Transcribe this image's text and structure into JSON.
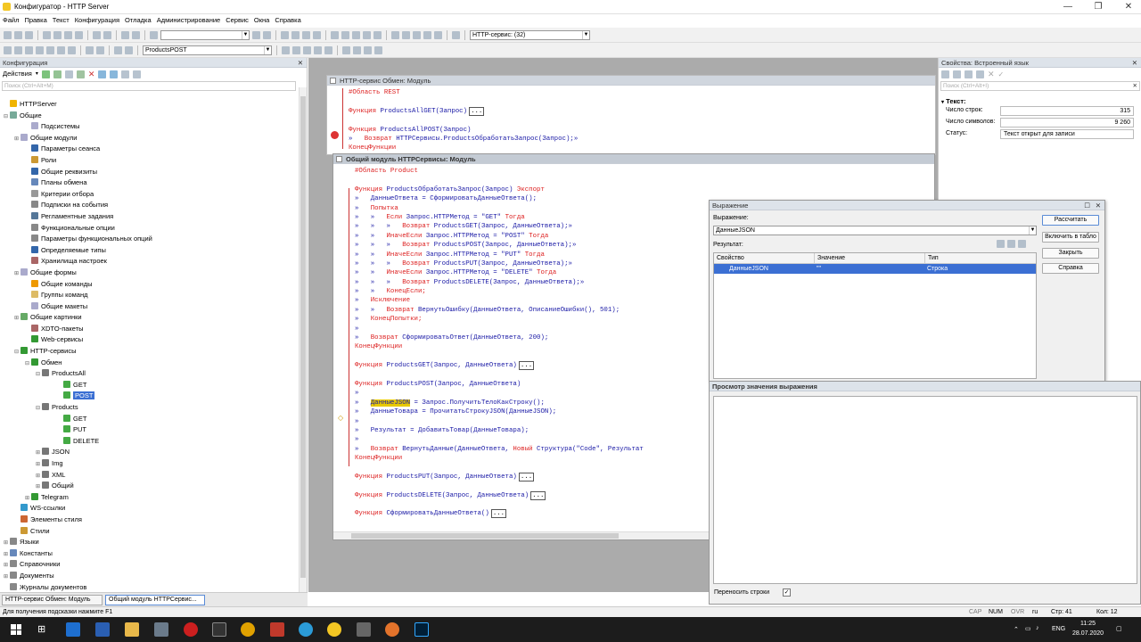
{
  "window": {
    "title": "Конфигуратор - HTTP Server"
  },
  "menu": [
    "Файл",
    "Правка",
    "Текст",
    "Конфигурация",
    "Отладка",
    "Администрирование",
    "Сервис",
    "Окна",
    "Справка"
  ],
  "toolbar": {
    "service_combo": "HTTP-сервис: (32)",
    "method_combo": "ProductsPOST"
  },
  "left": {
    "title": "Конфигурация",
    "actions": "Действия",
    "search_placeholder": "Поиск (Ctrl+Alt+M)",
    "tree": [
      {
        "t": "HTTPServer",
        "l": 0,
        "e": "",
        "c": "#f0b400"
      },
      {
        "t": "Общие",
        "l": 0,
        "e": "⊟",
        "c": "#7a9"
      },
      {
        "t": "Подсистемы",
        "l": 2,
        "e": "",
        "c": "#aac"
      },
      {
        "t": "Общие модули",
        "l": 1,
        "e": "⊞",
        "c": "#aac"
      },
      {
        "t": "Параметры сеанса",
        "l": 2,
        "e": "",
        "c": "#36a"
      },
      {
        "t": "Роли",
        "l": 2,
        "e": "",
        "c": "#c93"
      },
      {
        "t": "Общие реквизиты",
        "l": 2,
        "e": "",
        "c": "#36a"
      },
      {
        "t": "Планы обмена",
        "l": 2,
        "e": "",
        "c": "#68b"
      },
      {
        "t": "Критерии отбора",
        "l": 2,
        "e": "",
        "c": "#999"
      },
      {
        "t": "Подписки на события",
        "l": 2,
        "e": "",
        "c": "#888"
      },
      {
        "t": "Регламентные задания",
        "l": 2,
        "e": "",
        "c": "#579"
      },
      {
        "t": "Функциональные опции",
        "l": 2,
        "e": "",
        "c": "#888"
      },
      {
        "t": "Параметры функциональных опций",
        "l": 2,
        "e": "",
        "c": "#888"
      },
      {
        "t": "Определяемые типы",
        "l": 2,
        "e": "",
        "c": "#36a"
      },
      {
        "t": "Хранилища настроек",
        "l": 2,
        "e": "",
        "c": "#a66"
      },
      {
        "t": "Общие формы",
        "l": 1,
        "e": "⊞",
        "c": "#aac"
      },
      {
        "t": "Общие команды",
        "l": 2,
        "e": "",
        "c": "#e90"
      },
      {
        "t": "Группы команд",
        "l": 2,
        "e": "",
        "c": "#db6"
      },
      {
        "t": "Общие макеты",
        "l": 2,
        "e": "",
        "c": "#aac"
      },
      {
        "t": "Общие картинки",
        "l": 1,
        "e": "⊞",
        "c": "#6a6"
      },
      {
        "t": "XDTO-пакеты",
        "l": 2,
        "e": "",
        "c": "#a66"
      },
      {
        "t": "Web-сервисы",
        "l": 2,
        "e": "",
        "c": "#393"
      },
      {
        "t": "HTTP-сервисы",
        "l": 1,
        "e": "⊟",
        "c": "#393"
      },
      {
        "t": "Обмен",
        "l": 2,
        "e": "⊟",
        "c": "#393"
      },
      {
        "t": "ProductsAll",
        "l": 3,
        "e": "⊟",
        "c": "#777"
      },
      {
        "t": "GET",
        "l": 5,
        "e": "",
        "c": "#4a4"
      },
      {
        "t": "POST",
        "l": 5,
        "e": "",
        "c": "#4a4",
        "sel": true
      },
      {
        "t": "Products",
        "l": 3,
        "e": "⊟",
        "c": "#777"
      },
      {
        "t": "GET",
        "l": 5,
        "e": "",
        "c": "#4a4"
      },
      {
        "t": "PUT",
        "l": 5,
        "e": "",
        "c": "#4a4"
      },
      {
        "t": "DELETE",
        "l": 5,
        "e": "",
        "c": "#4a4"
      },
      {
        "t": "JSON",
        "l": 3,
        "e": "⊞",
        "c": "#777"
      },
      {
        "t": "Img",
        "l": 3,
        "e": "⊞",
        "c": "#777"
      },
      {
        "t": "XML",
        "l": 3,
        "e": "⊞",
        "c": "#777"
      },
      {
        "t": "Общий",
        "l": 3,
        "e": "⊞",
        "c": "#777"
      },
      {
        "t": "Telegram",
        "l": 2,
        "e": "⊞",
        "c": "#393"
      },
      {
        "t": "WS-ссылки",
        "l": 1,
        "e": "",
        "c": "#39c"
      },
      {
        "t": "Элементы стиля",
        "l": 1,
        "e": "",
        "c": "#c63"
      },
      {
        "t": "Стили",
        "l": 1,
        "e": "",
        "c": "#c93"
      },
      {
        "t": "Языки",
        "l": 0,
        "e": "⊞",
        "c": "#888"
      },
      {
        "t": "Константы",
        "l": 0,
        "e": "⊞",
        "c": "#68b"
      },
      {
        "t": "Справочники",
        "l": 0,
        "e": "⊞",
        "c": "#888"
      },
      {
        "t": "Документы",
        "l": 0,
        "e": "⊞",
        "c": "#888"
      },
      {
        "t": "Журналы документов",
        "l": 0,
        "e": "",
        "c": "#888"
      }
    ]
  },
  "editor1": {
    "title": "HTTP-сервис Обмен: Модуль",
    "lines": [
      [
        [
          "kw",
          "#Область REST"
        ]
      ],
      [],
      [
        [
          "kw",
          "Функция "
        ],
        [
          "fn",
          "ProductsAllGET(Запрос)"
        ],
        [
          "box",
          "..."
        ]
      ],
      [],
      [
        [
          "kw",
          "Функция "
        ],
        [
          "fn",
          "ProductsAllPOST(Запрос)"
        ]
      ],
      [
        [
          "p",
          "»   "
        ],
        [
          "kw",
          "Возврат "
        ],
        [
          "fn",
          "HTTPСервисы.ProductsОбработатьЗапрос(Запрос);"
        ],
        [
          "p",
          "»"
        ]
      ],
      [
        [
          "kw",
          "КонецФункции"
        ]
      ]
    ]
  },
  "editor2": {
    "title": "Общий модуль HTTPСервисы: Модуль",
    "lines": [
      [
        [
          "kw",
          "#Область Product"
        ]
      ],
      [],
      [
        [
          "kw",
          "Функция "
        ],
        [
          "fn",
          "ProductsОбработатьЗапрос(Запрос) "
        ],
        [
          "kw",
          "Экспорт"
        ]
      ],
      [
        [
          "p",
          "»   "
        ],
        [
          "fn",
          "ДанныеОтвета = СформироватьДанныеОтвета();"
        ]
      ],
      [
        [
          "p",
          "»   "
        ],
        [
          "kw",
          "Попытка"
        ]
      ],
      [
        [
          "p",
          "»   »   "
        ],
        [
          "kw",
          "Если "
        ],
        [
          "fn",
          "Запрос.HTTPМетод = \"GET\" "
        ],
        [
          "kw",
          "Тогда"
        ]
      ],
      [
        [
          "p",
          "»   »   »   "
        ],
        [
          "kw",
          "Возврат "
        ],
        [
          "fn",
          "ProductsGET(Запрос, ДанныеОтвета);"
        ],
        [
          "p",
          "»"
        ]
      ],
      [
        [
          "p",
          "»   »   "
        ],
        [
          "kw",
          "ИначеЕсли "
        ],
        [
          "fn",
          "Запрос.HTTPМетод = \"POST\" "
        ],
        [
          "kw",
          "Тогда"
        ]
      ],
      [
        [
          "p",
          "»   »   »   "
        ],
        [
          "kw",
          "Возврат "
        ],
        [
          "fn",
          "ProductsPOST(Запрос, ДанныеОтвета);"
        ],
        [
          "p",
          "»"
        ]
      ],
      [
        [
          "p",
          "»   »   "
        ],
        [
          "kw",
          "ИначеЕсли "
        ],
        [
          "fn",
          "Запрос.HTTPМетод = \"PUT\" "
        ],
        [
          "kw",
          "Тогда"
        ]
      ],
      [
        [
          "p",
          "»   »   »   "
        ],
        [
          "kw",
          "Возврат "
        ],
        [
          "fn",
          "ProductsPUT(Запрос, ДанныеОтвета);"
        ],
        [
          "p",
          "»"
        ]
      ],
      [
        [
          "p",
          "»   »   "
        ],
        [
          "kw",
          "ИначеЕсли "
        ],
        [
          "fn",
          "Запрос.HTTPМетод = \"DELETE\" "
        ],
        [
          "kw",
          "Тогда"
        ]
      ],
      [
        [
          "p",
          "»   »   »   "
        ],
        [
          "kw",
          "Возврат "
        ],
        [
          "fn",
          "ProductsDELETE(Запрос, ДанныеОтвета);"
        ],
        [
          "p",
          "»"
        ]
      ],
      [
        [
          "p",
          "»   »   "
        ],
        [
          "kw",
          "КонецЕсли;"
        ]
      ],
      [
        [
          "p",
          "»   "
        ],
        [
          "kw",
          "Исключение"
        ]
      ],
      [
        [
          "p",
          "»   »   "
        ],
        [
          "kw",
          "Возврат "
        ],
        [
          "fn",
          "ВернутьОшибку(ДанныеОтвета, ОписаниеОшибки(), 501);"
        ]
      ],
      [
        [
          "p",
          "»   "
        ],
        [
          "kw",
          "КонецПопытки;"
        ]
      ],
      [
        [
          "p",
          "»"
        ]
      ],
      [
        [
          "p",
          "»   "
        ],
        [
          "kw",
          "Возврат "
        ],
        [
          "fn",
          "СформироватьОтвет(ДанныеОтвета, 200);"
        ]
      ],
      [
        [
          "kw",
          "КонецФункции"
        ]
      ],
      [],
      [
        [
          "kw",
          "Функция "
        ],
        [
          "fn",
          "ProductsGET(Запрос, ДанныеОтвета)"
        ],
        [
          "box",
          "..."
        ]
      ],
      [],
      [
        [
          "kw",
          "Функция "
        ],
        [
          "fn",
          "ProductsPOST(Запрос, ДанныеОтвета)"
        ]
      ],
      [
        [
          "p",
          "»"
        ]
      ],
      [
        [
          "p",
          "»   "
        ],
        [
          "hl",
          "ДанныеJSON"
        ],
        [
          "fn",
          " = Запрос.ПолучитьТелоКакСтроку();"
        ]
      ],
      [
        [
          "p",
          "»   "
        ],
        [
          "fn",
          "ДанныеТовара = ПрочитатьСтрокуJSON(ДанныеJSON);"
        ]
      ],
      [
        [
          "p",
          "»"
        ]
      ],
      [
        [
          "p",
          "»   "
        ],
        [
          "fn",
          "Результат = ДобавитьТовар(ДанныеТовара);"
        ]
      ],
      [
        [
          "p",
          "»"
        ]
      ],
      [
        [
          "p",
          "»   "
        ],
        [
          "kw",
          "Возврат "
        ],
        [
          "fn",
          "ВернутьДанные(ДанныеОтвета, "
        ],
        [
          "kw",
          "Новый "
        ],
        [
          "fn",
          "Структура(\"Code\", Результат"
        ]
      ],
      [
        [
          "kw",
          "КонецФункции"
        ]
      ],
      [],
      [
        [
          "kw",
          "Функция "
        ],
        [
          "fn",
          "ProductsPUT(Запрос, ДанныеОтвета)"
        ],
        [
          "box",
          "..."
        ]
      ],
      [],
      [
        [
          "kw",
          "Функция "
        ],
        [
          "fn",
          "ProductsDELETE(Запрос, ДанныеОтвета)"
        ],
        [
          "box",
          "..."
        ]
      ],
      [],
      [
        [
          "kw",
          "Функция "
        ],
        [
          "fn",
          "СформироватьДанныеОтвета()"
        ],
        [
          "box",
          "..."
        ]
      ]
    ]
  },
  "right": {
    "title": "Свойства: Встроенный язык",
    "search_placeholder": "Поиск (Ctrl+Alt+I)",
    "group": "Текст:",
    "rows": [
      {
        "label": "Число строк:",
        "value": "315",
        "align": "right"
      },
      {
        "label": "Число символов:",
        "value": "9 260",
        "align": "right"
      },
      {
        "label": "Статус:",
        "value": "Текст открыт для записи",
        "align": "left"
      }
    ]
  },
  "expr": {
    "title": "Выражение",
    "expr_label": "Выражение:",
    "expr_value": "ДанныеJSON",
    "result_label": "Результат:",
    "cols": [
      "Свойство",
      "Значение",
      "Тип"
    ],
    "row": [
      "ДанныеJSON",
      "\"\"",
      "Строка"
    ],
    "buttons": [
      "Рассчитать",
      "Включить в табло",
      "Закрыть",
      "Справка"
    ]
  },
  "view": {
    "title": "Просмотр значения выражения",
    "wrap_label": "Переносить строки",
    "wrap_check": "✓"
  },
  "tabs": [
    "HTTP-сервис Обмен: Модуль",
    "Общий модуль HTTPСервис..."
  ],
  "status": {
    "hint": "Для получения подсказки нажмите F1",
    "cap": "CAP",
    "num": "NUM",
    "ovr": "OVR",
    "lang": "ru",
    "line": "Стр: 41",
    "col": "Кол: 12"
  },
  "taskbar": {
    "lang": "ENG",
    "time": "11:25",
    "date": "28.07.2020"
  }
}
